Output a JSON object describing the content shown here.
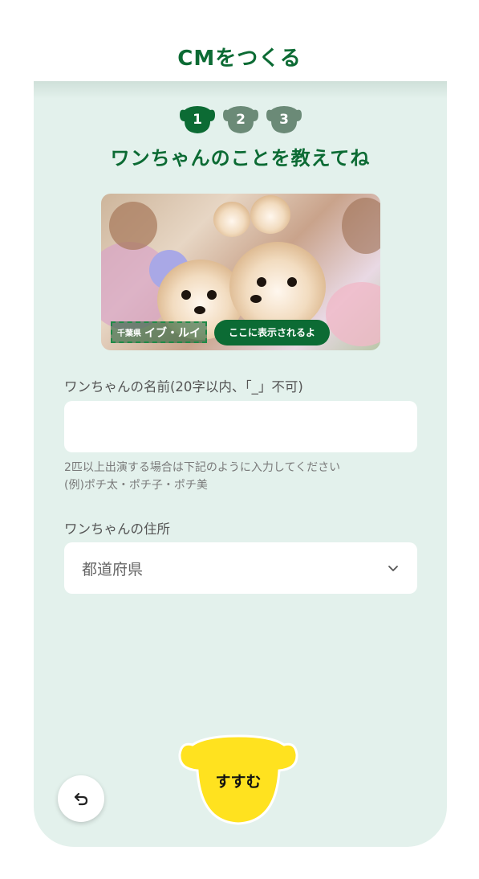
{
  "page": {
    "title": "CMをつくる"
  },
  "steps": [
    {
      "number": "1",
      "state": "active",
      "color": "#0c6b34"
    },
    {
      "number": "2",
      "state": "inactive",
      "color": "#6b8a77"
    },
    {
      "number": "3",
      "state": "inactive",
      "color": "#6b8a77"
    }
  ],
  "heading": "ワンちゃんのことを教えてね",
  "preview": {
    "prefecture_tag": "千葉県",
    "dog_names": "イブ・ルイ",
    "badge": "ここに表示されるよ"
  },
  "name_field": {
    "label": "ワンちゃんの名前(20字以内、「_」不可)",
    "value": "",
    "hint_line1": "2匹以上出演する場合は下記のように入力してください",
    "hint_line2": "(例)ポチ太・ポチ子・ポチ美"
  },
  "address_field": {
    "label": "ワンちゃんの住所",
    "selected": "都道府県"
  },
  "buttons": {
    "next": "すすむ",
    "back_icon": "undo-icon"
  },
  "colors": {
    "brand_green": "#0c6b34",
    "card_bg": "#e3f1ec",
    "next_yellow": "#ffe21f"
  }
}
